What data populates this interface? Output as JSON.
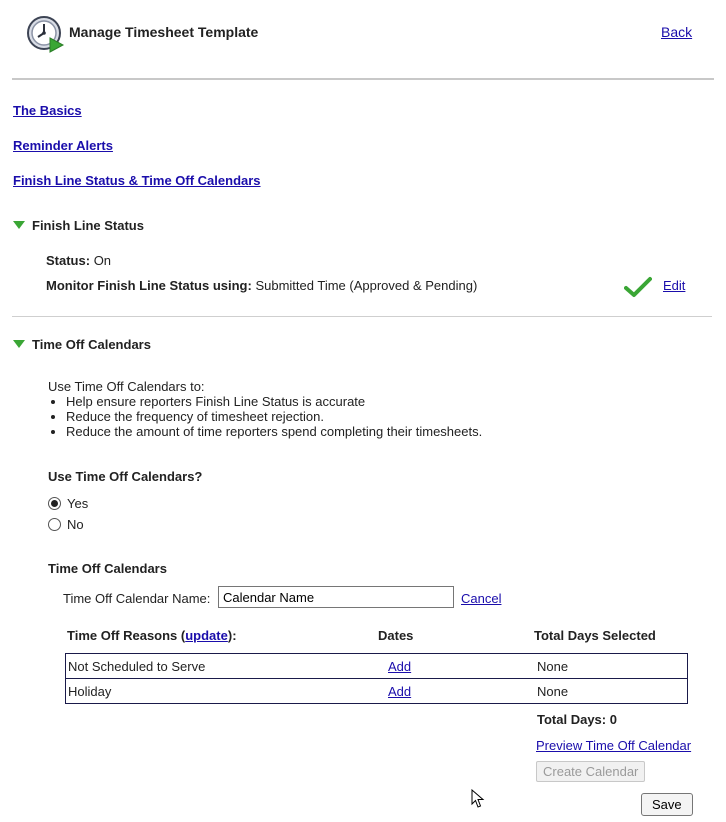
{
  "header": {
    "title": "Manage Timesheet Template",
    "back_label": "Back",
    "logo_icon": "clock-play-icon"
  },
  "nav": {
    "basics": "The Basics",
    "reminders": "Reminder Alerts",
    "finish_line": "Finish Line Status & Time Off Calendars"
  },
  "finish_line_section": {
    "title": "Finish Line Status",
    "status_label": "Status:",
    "status_value": "On",
    "monitor_label": "Monitor Finish Line Status using:",
    "monitor_value": "Submitted Time (Approved & Pending)",
    "edit_label": "Edit"
  },
  "time_off_section": {
    "title": "Time Off Calendars",
    "intro": "Use Time Off Calendars to:",
    "bullets": [
      "Help ensure reporters Finish Line Status is accurate",
      "Reduce the frequency of timesheet rejection.",
      "Reduce the amount of time reporters spend completing their timesheets."
    ],
    "question": "Use Time Off Calendars?",
    "options": [
      "Yes",
      "No"
    ],
    "selected": "Yes",
    "calendars_heading": "Time Off Calendars",
    "name_label": "Time Off Calendar Name:",
    "name_value": "Calendar Name",
    "cancel_label": "Cancel",
    "table": {
      "col_reasons_prefix": "Time Off Reasons (",
      "col_reasons_link": "update",
      "col_reasons_suffix": "):",
      "col_dates": "Dates",
      "col_total": "Total Days Selected",
      "rows": [
        {
          "reason": "Not Scheduled to Serve",
          "dates": "Add",
          "total": "None"
        },
        {
          "reason": "Holiday",
          "dates": "Add",
          "total": "None"
        }
      ]
    },
    "total_days": "Total Days: 0",
    "preview_label": "Preview Time Off Calendar",
    "create_label": "Create Calendar",
    "save_label": "Save"
  },
  "colors": {
    "link": "#1a0dab",
    "accent_green": "#3aa635"
  }
}
